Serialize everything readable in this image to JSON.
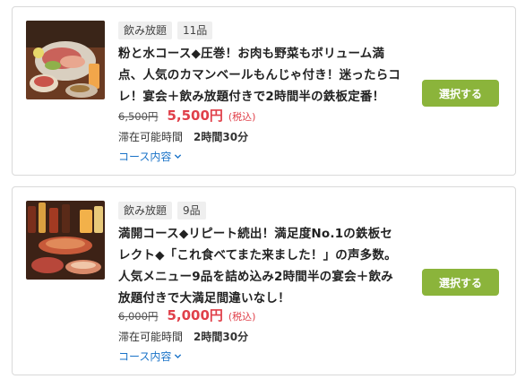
{
  "plans": [
    {
      "tags": [
        "飲み放題",
        "11品"
      ],
      "title": "粉と水コース◆圧巻！お肉も野菜もボリューム満点、人気のカマンベールもんじゃ付き！迷ったらコレ！宴会＋飲み放題付きで2時間半の鉄板定番！",
      "old_price": "6,500円",
      "new_price": "5,500円",
      "tax_note": "(税込)",
      "stay_label": "滞在可能時間",
      "stay_value": "2時間30分",
      "course_link": "コース内容",
      "select_label": "選択する",
      "image_icon": "food-photo"
    },
    {
      "tags": [
        "飲み放題",
        "9品"
      ],
      "title": "満開コース◆リピート続出！満足度No.1の鉄板セレクト◆「これ食べてまた来ました！」の声多数。人気メニュー9品を詰め込み2時間半の宴会＋飲み放題付きで大満足間違いなし！",
      "old_price": "6,000円",
      "new_price": "5,000円",
      "tax_note": "(税込)",
      "stay_label": "滞在可能時間",
      "stay_value": "2時間30分",
      "course_link": "コース内容",
      "select_label": "選択する",
      "image_icon": "food-drinks-photo"
    }
  ],
  "colors": {
    "accent_green": "#8bb43b",
    "price_red": "#e0404a",
    "link_blue": "#1a73c8"
  }
}
